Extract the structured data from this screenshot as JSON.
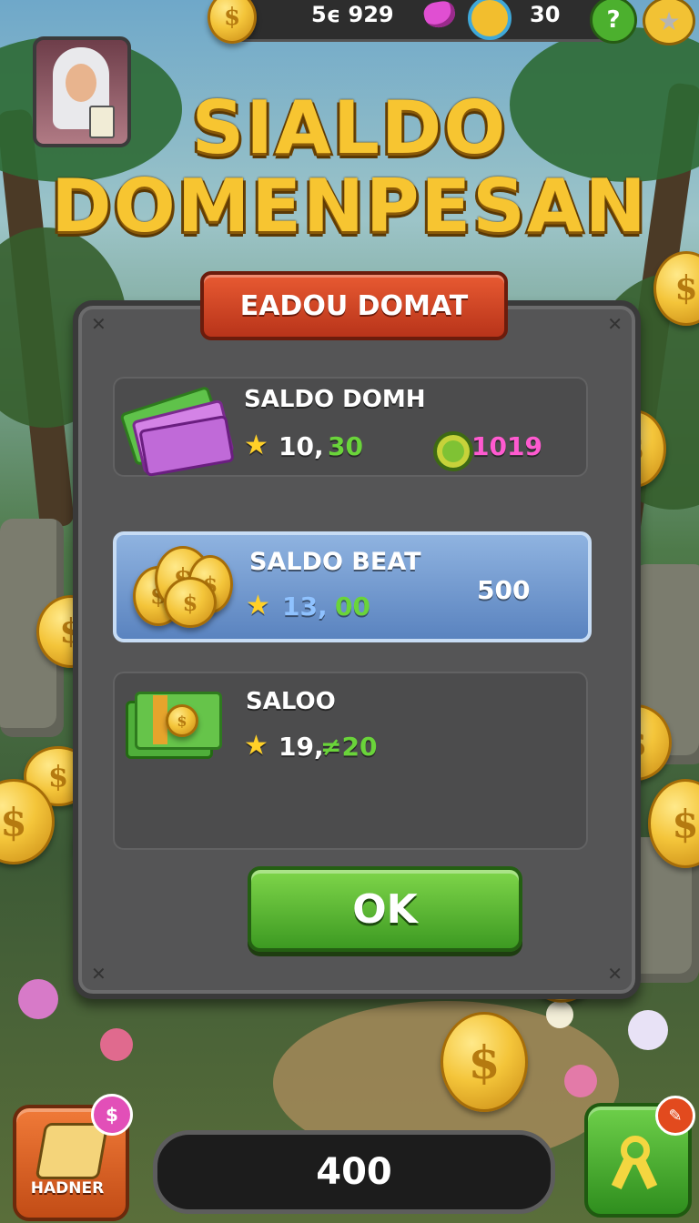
{
  "topbar": {
    "coins_value": "5ϵ 929",
    "gems_value": "30",
    "help_label": "?",
    "coin_symbol": "$"
  },
  "title": {
    "line1": "SIALDO",
    "line2": "DOMENPESAN"
  },
  "panel": {
    "ribbon_label": "EADOU DOMAT",
    "rows": [
      {
        "label": "SALDO DOMH",
        "stat_a": "10,",
        "stat_b": "30",
        "extra_value": "1019",
        "icon": "cash-stack-icon"
      },
      {
        "label": "SALDO BEAT",
        "stat_a": "13,",
        "stat_b": "00",
        "extra_value": "500",
        "icon": "coin-pile-icon"
      },
      {
        "label": "SALOO",
        "stat_a": "19,",
        "stat_b": "≠20",
        "icon": "banknote-icon"
      }
    ],
    "ok_label": "OK"
  },
  "bottom": {
    "left_button_label": "HADNER",
    "left_badge": "$",
    "center_value": "400",
    "right_badge_icon": "bell-icon",
    "right_icon": "ribbon-icon"
  },
  "colors": {
    "title_gold": "#f7c531",
    "ribbon_red": "#d8441f",
    "ok_green": "#4fb22a",
    "highlight_row": "#7aa4d8",
    "pink_value": "#ff5ad0",
    "green_value": "#6ad43a"
  }
}
